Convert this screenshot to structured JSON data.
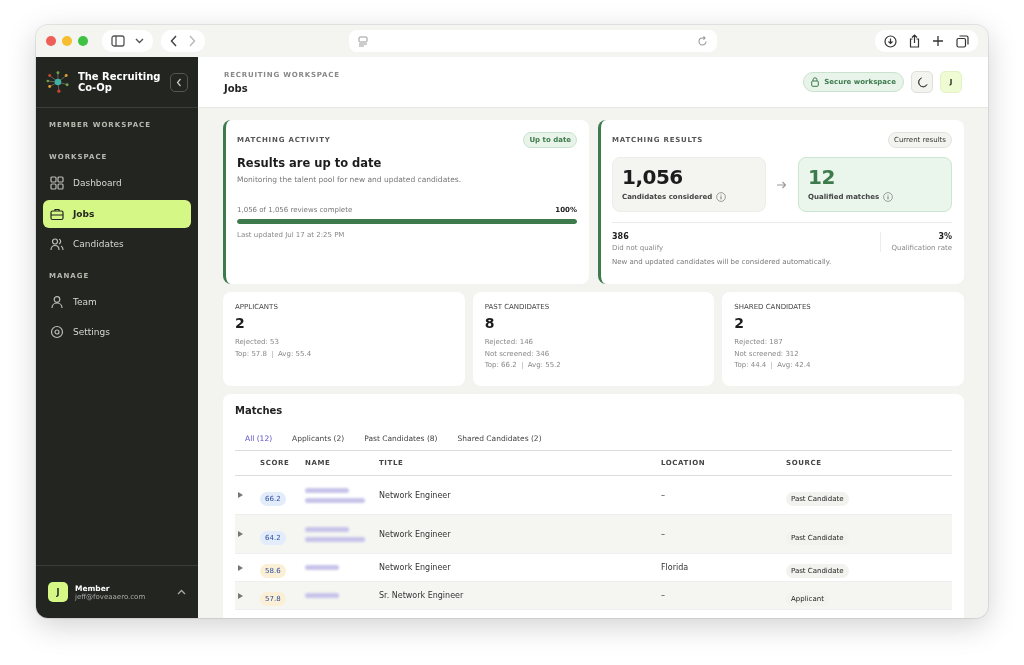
{
  "brand": {
    "name": "The Recruiting Co-Op"
  },
  "sidebar": {
    "workspace_label": "MEMBER WORKSPACE",
    "sections": [
      {
        "label": "WORKSPACE",
        "items": [
          {
            "label": "Dashboard",
            "kind": "grid",
            "selected": false
          },
          {
            "label": "Jobs",
            "kind": "briefcase",
            "selected": true
          },
          {
            "label": "Candidates",
            "kind": "people",
            "selected": false
          }
        ]
      },
      {
        "label": "MANAGE",
        "items": [
          {
            "label": "Team",
            "kind": "person",
            "selected": false
          },
          {
            "label": "Settings",
            "kind": "gear",
            "selected": false
          }
        ]
      }
    ],
    "user": {
      "initial": "J",
      "role": "Member",
      "email": "jeff@foveaaero.com"
    }
  },
  "header": {
    "eyebrow": "RECRUITING WORKSPACE",
    "title": "Jobs",
    "secure_badge": "Secure workspace",
    "avatar": "J"
  },
  "matching_activity": {
    "label": "MATCHING ACTIVITY",
    "badge": "Up to date",
    "title": "Results are up to date",
    "subtitle": "Monitoring the talent pool for new and updated candidates.",
    "progress_text": "1,056 of 1,056 reviews complete",
    "percent": "100%",
    "level": 1,
    "updated": "Last updated Jul 17 at 2:25 PM"
  },
  "matching_results": {
    "label": "MATCHING RESULTS",
    "badge": "Current results",
    "considered": {
      "value": "1,056",
      "label": "Candidates considered"
    },
    "qualified": {
      "value": "12",
      "label": "Qualified matches"
    },
    "not_qualified": {
      "value": "386",
      "label": "Did not qualify"
    },
    "rate": {
      "value": "3%",
      "label": "Qualification rate"
    },
    "note": "New and updated candidates will be considered automatically."
  },
  "stat_cards": [
    {
      "label": "APPLICANTS",
      "value": "2",
      "details": [
        "Rejected: 53"
      ],
      "top": "Top: 57.8",
      "avg": "Avg: 55.4"
    },
    {
      "label": "PAST CANDIDATES",
      "value": "8",
      "details": [
        "Rejected: 146",
        "Not screened: 346"
      ],
      "top": "Top: 66.2",
      "avg": "Avg: 55.2"
    },
    {
      "label": "SHARED CANDIDATES",
      "value": "2",
      "details": [
        "Rejected: 187",
        "Not screened: 312"
      ],
      "top": "Top: 44.4",
      "avg": "Avg: 42.4"
    }
  ],
  "matches": {
    "title": "Matches",
    "tabs": [
      {
        "label": "All (12)",
        "selected": true
      },
      {
        "label": "Applicants (2)",
        "selected": false
      },
      {
        "label": "Past Candidates (8)",
        "selected": false
      },
      {
        "label": "Shared Candidates (2)",
        "selected": false
      }
    ],
    "columns": [
      "SCORE",
      "NAME",
      "TITLE",
      "LOCATION",
      "SOURCE"
    ],
    "rows": [
      {
        "score": "66.2",
        "color": "#e3ecfb",
        "title": "Network Engineer",
        "location": "–",
        "source": "Past Candidate"
      },
      {
        "score": "64.2",
        "color": "#e3ecfb",
        "title": "Network Engineer",
        "location": "–",
        "source": "Past Candidate"
      },
      {
        "score": "58.6",
        "color": "#fbf0d6",
        "title": "Network Engineer",
        "location": "Florida",
        "source": "Past Candidate"
      },
      {
        "score": "57.8",
        "color": "#fbf0d6",
        "title": "Sr. Network Engineer",
        "location": "–",
        "source": "Applicant"
      }
    ]
  }
}
